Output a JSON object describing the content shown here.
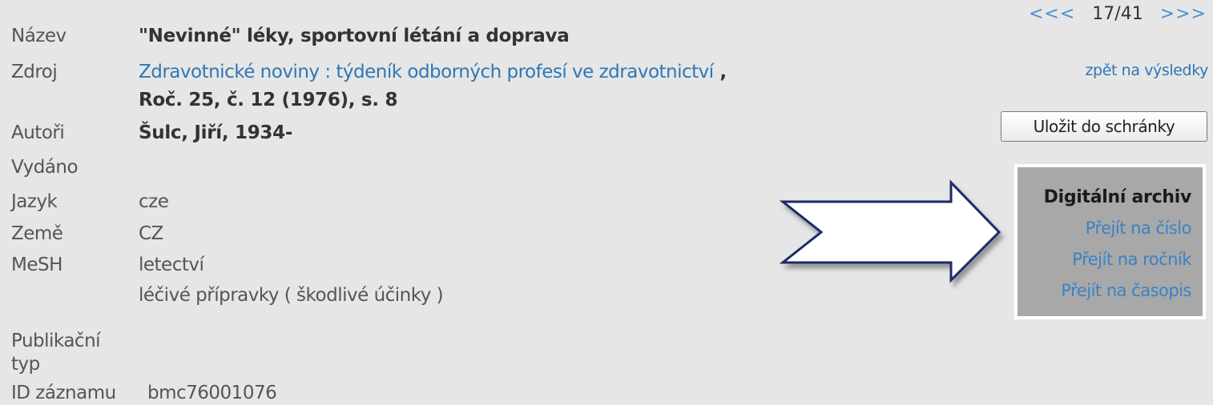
{
  "nav": {
    "prev": "<<<",
    "position": "17/41",
    "next": ">>>",
    "back_link": "zpět na výsledky"
  },
  "save_button": "Uložit do schránky",
  "archive": {
    "title": "Digitální archiv",
    "links": [
      "Přejít na číslo",
      "Přejít na ročník",
      "Přejít na časopis"
    ]
  },
  "record": {
    "title_label": "Název",
    "title": "\"Nevinné\" léky, sportovní létání a doprava",
    "source_label": "Zdroj",
    "source_link": "Zdravotnické noviny : týdeník odborných profesí ve zdravotnictví",
    "source_comma": " ,",
    "source_detail": "Roč. 25, č. 12 (1976), s. 8",
    "authors_label": "Autoři",
    "authors": "Šulc, Jiří, 1934-",
    "published_label": "Vydáno",
    "language_label": "Jazyk",
    "language": "cze",
    "country_label": "Země",
    "country": "CZ",
    "mesh_label": "MeSH",
    "mesh": [
      "letectví",
      "léčivé přípravky ( škodlivé účinky )"
    ],
    "pubtype_label_line1": "Publikační",
    "pubtype_label_line2": "typ",
    "id_label": "ID záznamu",
    "id": "bmc76001076"
  },
  "colors": {
    "background": "#e6e6e6",
    "link": "#2e77b5",
    "archive_box": "#a8a8a8",
    "arrow_outline": "#1f2a6b"
  },
  "icons": [
    "right-arrow-icon"
  ]
}
